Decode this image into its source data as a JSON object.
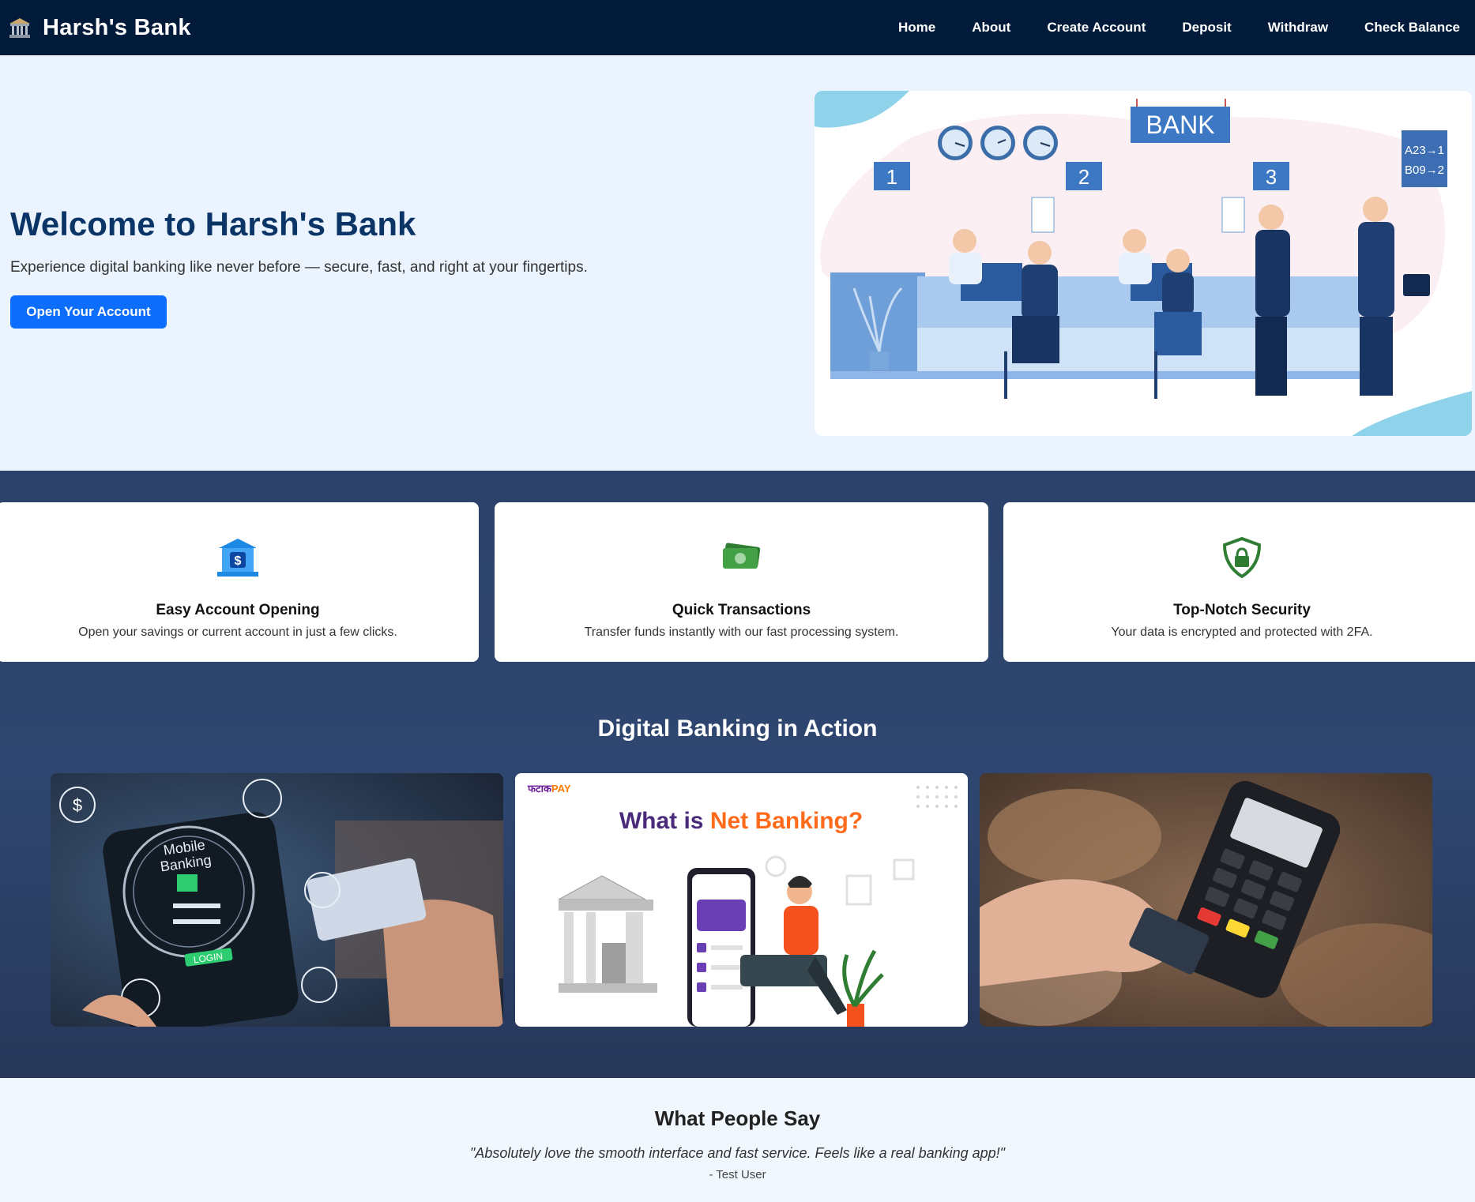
{
  "navbar": {
    "brand": "Harsh's Bank",
    "links": [
      "Home",
      "About",
      "Create Account",
      "Deposit",
      "Withdraw",
      "Check Balance"
    ]
  },
  "hero": {
    "title": "Welcome to Harsh's Bank",
    "subtitle": "Experience digital banking like never before — secure, fast, and right at your fingertips.",
    "cta": "Open Your Account",
    "illustration": {
      "sign": "BANK",
      "counters": [
        "1",
        "2",
        "3"
      ],
      "queue_board": [
        "A23→1",
        "B09→2"
      ]
    }
  },
  "features": [
    {
      "title": "Easy Account Opening",
      "desc": "Open your savings or current account in just a few clicks.",
      "icon": "bank-dollar-icon"
    },
    {
      "title": "Quick Transactions",
      "desc": "Transfer funds instantly with our fast processing system.",
      "icon": "cash-icon"
    },
    {
      "title": "Top-Notch Security",
      "desc": "Your data is encrypted and protected with 2FA.",
      "icon": "shield-lock-icon"
    }
  ],
  "gallery": {
    "title": "Digital Banking in Action",
    "images": [
      {
        "text": [
          "Mobile",
          "Banking",
          "LOGIN"
        ]
      },
      {
        "logo_a": "फटाक",
        "logo_b": "PAY",
        "heading_a": "What is ",
        "heading_b": "Net Banking?"
      },
      {
        "text": []
      }
    ]
  },
  "testimonials": {
    "title": "What People Say",
    "quote": "\"Absolutely love the smooth interface and fast service. Feels like a real banking app!\"",
    "author": "- Test User"
  },
  "colors": {
    "nav_bg": "#031b3a",
    "hero_bg": "#eaf3fe",
    "accent": "#0d6efd",
    "dark_bg": "#2c426a",
    "title": "#0b3566"
  }
}
